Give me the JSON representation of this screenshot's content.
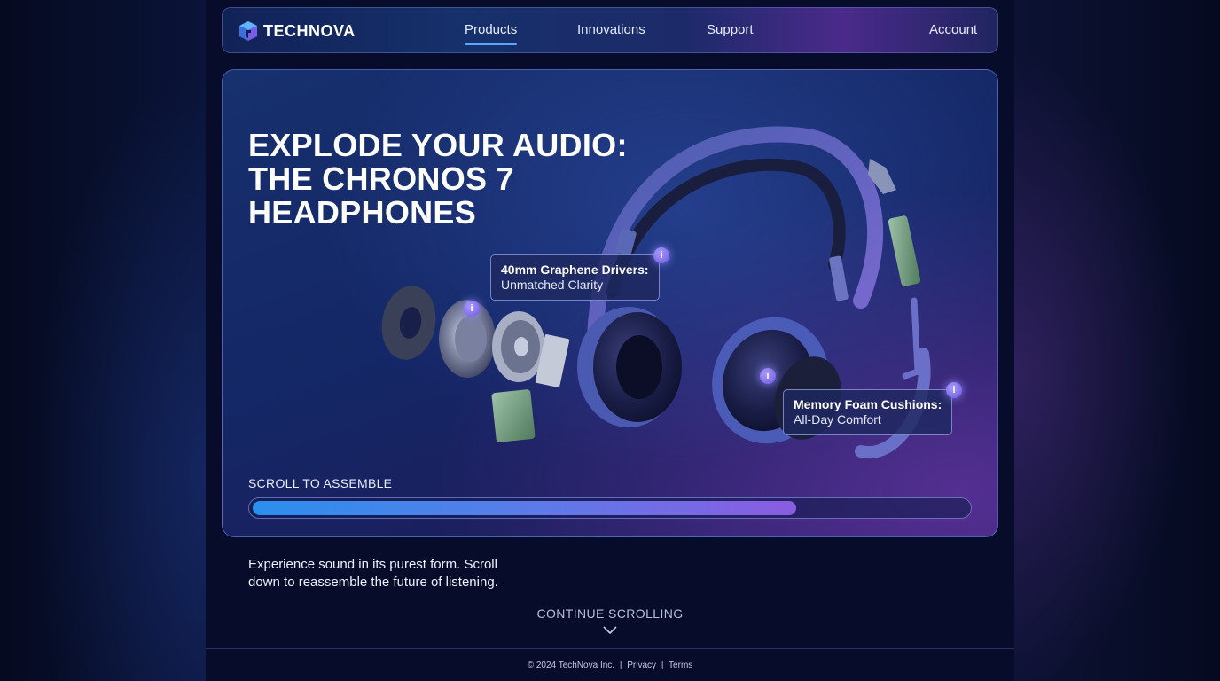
{
  "brand": {
    "name": "TECHNOVA",
    "logo_icon": "technova-cube-logo"
  },
  "nav": {
    "links": [
      {
        "label": "Products",
        "active": true
      },
      {
        "label": "Innovations",
        "active": false
      },
      {
        "label": "Support",
        "active": false
      }
    ],
    "account_label": "Account"
  },
  "hero": {
    "title_lines": [
      "EXPLODE YOUR AUDIO:",
      "THE CHRONOS 7",
      "HEADPHONES"
    ],
    "callouts": [
      {
        "title": "40mm Graphene Drivers:",
        "subtitle": "Unmatched Clarity"
      },
      {
        "title": "Memory Foam Cushions:",
        "subtitle": "All-Day Comfort"
      }
    ],
    "info_glyph": "i",
    "scroll_label": "SCROLL TO ASSEMBLE",
    "progress_fraction": 0.76
  },
  "tagline": "Experience sound in its purest form. Scroll down to reassemble the future of listening.",
  "continue_label": "CONTINUE SCROLLING",
  "footer": {
    "copyright": "© 2024 TechNova Inc.",
    "privacy": "Privacy",
    "terms": "Terms",
    "separator": "|"
  },
  "colors": {
    "background": "#060c2a",
    "accent_blue": "#2a8fee",
    "accent_purple": "#8a5ce2",
    "active_underline": "#53a8ff"
  }
}
